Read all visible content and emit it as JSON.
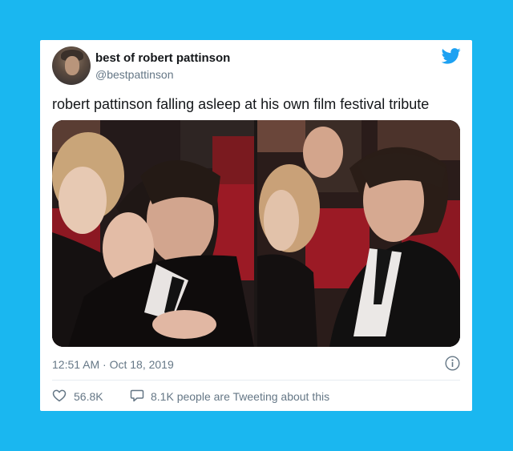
{
  "tweet": {
    "display_name": "best of robert pattinson",
    "handle": "@bestpattinson",
    "text": "robert pattinson falling asleep at his own film festival tribute",
    "timestamp": "12:51 AM · Oct 18, 2019",
    "likes": "56.8K",
    "conversation": "8.1K people are Tweeting about this"
  },
  "colors": {
    "background": "#1ab7f0",
    "twitter_blue": "#1da1f2",
    "secondary_text": "#657786",
    "primary_text": "#14171a"
  },
  "icons": {
    "logo": "twitter-bird-icon",
    "info": "info-icon",
    "like": "heart-icon",
    "reply": "speech-bubble-icon"
  }
}
